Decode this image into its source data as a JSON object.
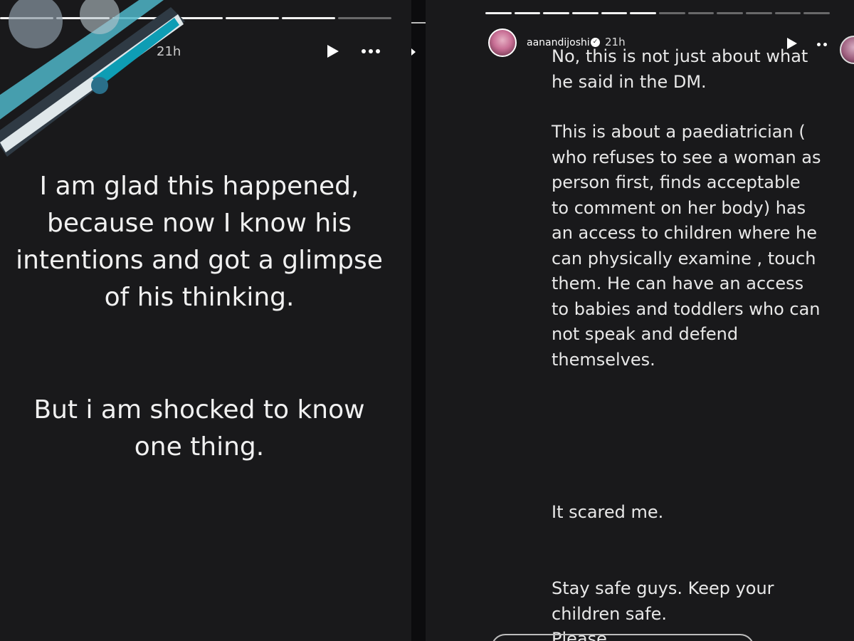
{
  "left_story": {
    "time": "21h",
    "paragraph1": "I am glad this happened, because now I know his intentions and got a glimpse of his thinking.",
    "paragraph2": "But i am shocked to know one thing."
  },
  "right_story": {
    "username": "aanandijoshi",
    "time": "21h",
    "paragraph1": "No, this is not just about what he said in the DM.",
    "paragraph2": "This is about a paediatrician ( who refuses to see a woman as person first, finds acceptable to comment on her body) has an access to children where he can physically examine , touch them. He can have an access to babies and toddlers who can not speak and defend themselves.",
    "paragraph3": "It scared me.",
    "paragraph4": "Stay safe guys. Keep your children safe.",
    "paragraph5_partial": "Please"
  },
  "colors": {
    "background": "#19191b",
    "text": "#ececec",
    "progress_done": "#f2f2f2",
    "progress_todo": "rgba(255,255,255,0.35)"
  },
  "icons": [
    "play-icon",
    "more-options-icon",
    "verified-badge-icon",
    "avatar"
  ]
}
